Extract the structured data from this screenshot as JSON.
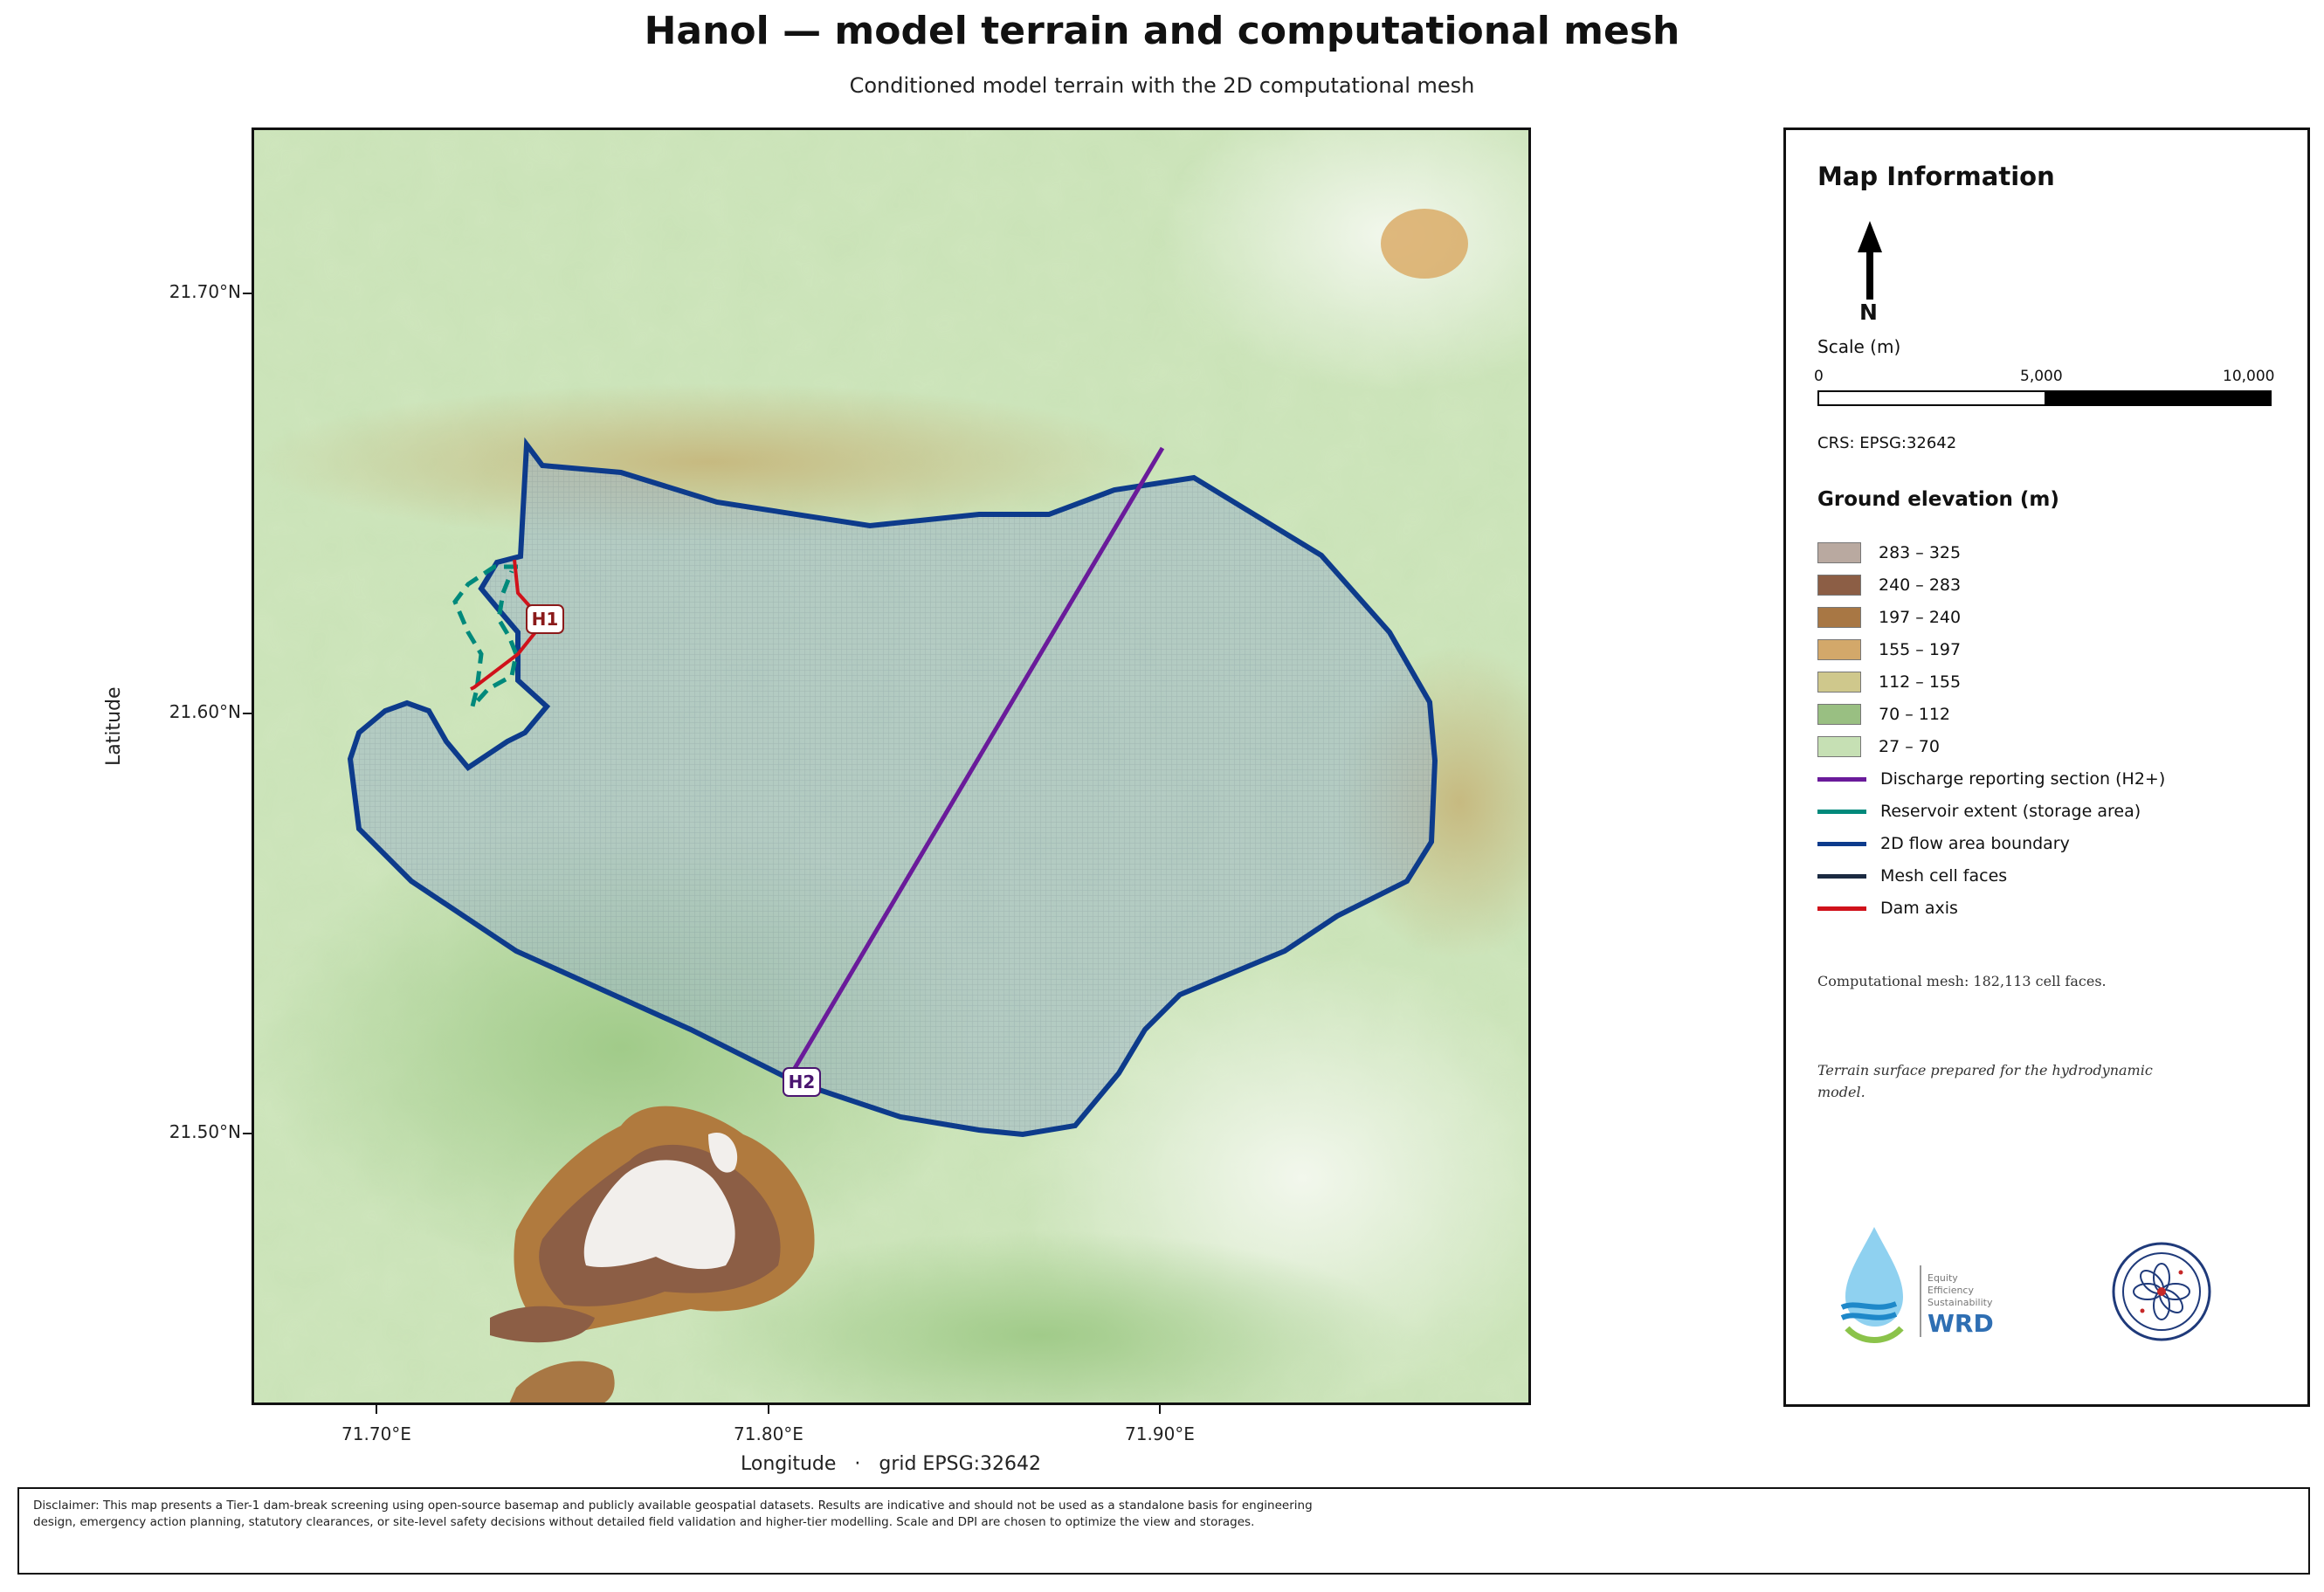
{
  "title": "Hanol — model terrain and computational mesh",
  "subtitle": "Conditioned model terrain with the 2D computational mesh",
  "axes": {
    "ylabel": "Latitude",
    "xlabel": "Longitude   ·   grid EPSG:32642",
    "yticks": [
      "21.70°N",
      "21.60°N",
      "21.50°N"
    ],
    "xticks": [
      "71.70°E",
      "71.80°E",
      "71.90°E"
    ]
  },
  "markers": {
    "h1": "H1",
    "h2": "H2"
  },
  "panel": {
    "title": "Map Information",
    "north": "N",
    "scale_label": "Scale (m)",
    "scale_ticks": [
      "0",
      "5,000",
      "10,000"
    ],
    "crs": "CRS: EPSG:32642",
    "elevation_title": "Ground elevation (m)",
    "elevation_classes": [
      {
        "label": "283 – 325",
        "color": "#b9a9a0"
      },
      {
        "label": "240 – 283",
        "color": "#8c5e45"
      },
      {
        "label": "197 – 240",
        "color": "#a87744"
      },
      {
        "label": "155 – 197",
        "color": "#d3a86a"
      },
      {
        "label": "112 – 155",
        "color": "#cfc88c"
      },
      {
        "label": "70 – 112",
        "color": "#99bf82"
      },
      {
        "label": "27 – 70",
        "color": "#c6e0b4"
      }
    ],
    "line_legend": [
      {
        "label": "Discharge reporting section (H2+)",
        "color": "#6a1b9a"
      },
      {
        "label": "Reservoir extent (storage area)",
        "color": "#00897b"
      },
      {
        "label": "2D flow area boundary",
        "color": "#0d3b8c"
      },
      {
        "label": "Mesh cell faces",
        "color": "#1b2a41"
      },
      {
        "label": "Dam axis",
        "color": "#d0121b"
      }
    ],
    "mesh_note": "Computational mesh: 182,113 cell faces.",
    "terrain_note": "Terrain surface prepared for the hydrodynamic model.",
    "logo_wrd_text": [
      "Equity",
      "Efficiency",
      "Sustainability",
      "WRD"
    ]
  },
  "disclaimer": "Disclaimer: This map presents a Tier-1 dam-break screening using open-source basemap and publicly available geospatial datasets. Results are indicative and should not be used as a standalone basis for engineering design, emergency action planning, statutory clearances, or site-level safety decisions without detailed field validation and higher-tier modelling. Scale and DPI are chosen to optimize the view and storages."
}
